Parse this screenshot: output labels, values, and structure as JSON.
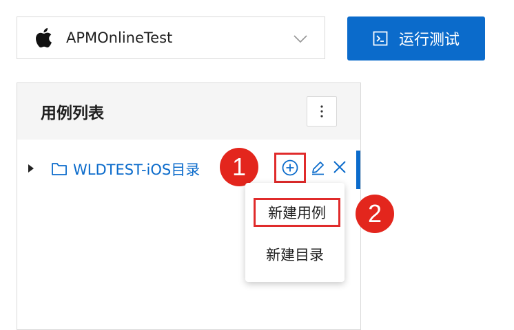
{
  "app_select": {
    "value": "APMOnlineTest",
    "icon": "apple-icon"
  },
  "run_button": {
    "label": "运行测试",
    "icon": "terminal-icon"
  },
  "panel": {
    "title": "用例列表",
    "tree": [
      {
        "name": "WLDTEST-iOS目录",
        "icon": "folder-icon"
      }
    ]
  },
  "context_menu": {
    "items": [
      "新建用例",
      "新建目录"
    ]
  },
  "annotations": {
    "step1": "1",
    "step2": "2"
  },
  "colors": {
    "primary": "#0b6bcb",
    "highlight": "#e02b2b",
    "badge": "#e3261d"
  }
}
